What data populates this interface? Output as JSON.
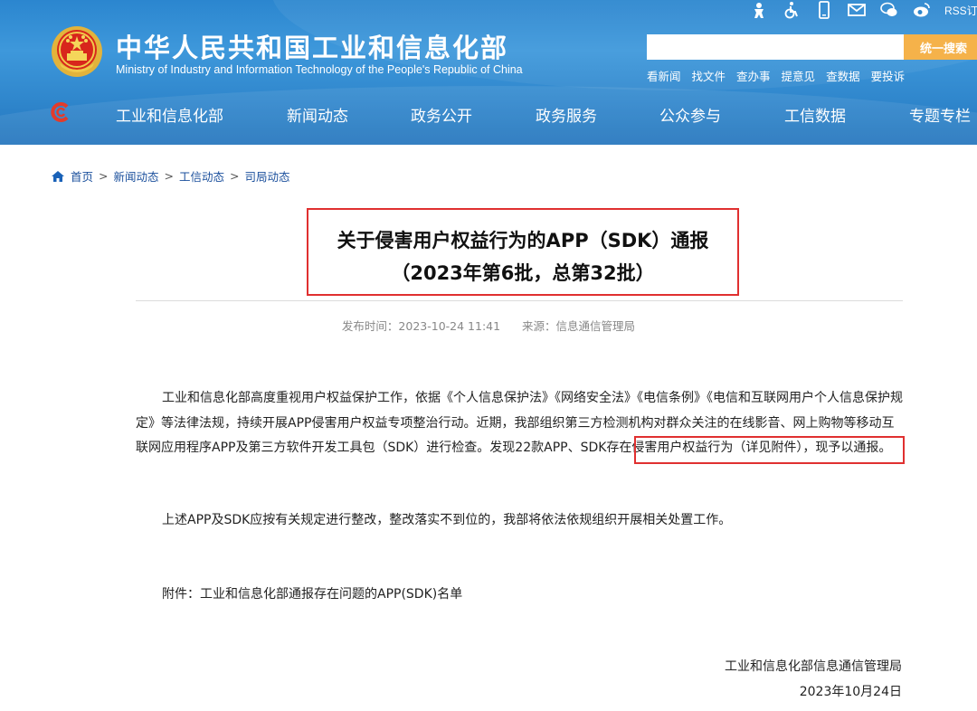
{
  "header": {
    "title": "中华人民共和国工业和信息化部",
    "subtitle": "Ministry of Industry and Information Technology of the People's Republic of China",
    "rss_label": "RSS订",
    "search": {
      "placeholder": "",
      "button_label": "统一搜索"
    },
    "quick_links": [
      "看新闻",
      "找文件",
      "查办事",
      "提意见",
      "查数据",
      "要投诉"
    ],
    "top_icons": [
      "accessibility-care-icon",
      "wheelchair-icon",
      "mobile-icon",
      "mail-icon",
      "wechat-icon",
      "weibo-icon"
    ]
  },
  "nav": {
    "items": [
      "工业和信息化部",
      "新闻动态",
      "政务公开",
      "政务服务",
      "公众参与",
      "工信数据",
      "专题专栏"
    ]
  },
  "breadcrumb": [
    "首页",
    "新闻动态",
    "工信动态",
    "司局动态"
  ],
  "article": {
    "title_line1": "关于侵害用户权益行为的APP（SDK）通报",
    "title_line2": "（2023年第6批，总第32批）",
    "publish_time": "发布时间：2023-10-24 11:41",
    "source": "来源：信息通信管理局",
    "paragraph1": "工业和信息化部高度重视用户权益保护工作，依据《个人信息保护法》《网络安全法》《电信条例》《电信和互联网用户个人信息保护规定》等法律法规，持续开展APP侵害用户权益专项整治行动。近期，我部组织第三方检测机构对群众关注的在线影音、网上购物等移动互联网应用程序APP及第三方软件开发工具包（SDK）进行检查。发现22款APP、SDK存在侵害用户权益行为（详见附件），现予以通报。",
    "paragraph2": "上述APP及SDK应按有关规定进行整改，整改落实不到位的，我部将依法依规组织开展相关处置工作。",
    "attachment": "附件：工业和信息化部通报存在问题的APP(SDK)名单",
    "signature": "工业和信息化部信息通信管理局",
    "date": "2023年10月24日"
  },
  "colors": {
    "header_blue": "#2f86cc",
    "search_button": "#f5b24a",
    "highlight_red": "#e03030",
    "link_blue": "#1a4f9c"
  }
}
